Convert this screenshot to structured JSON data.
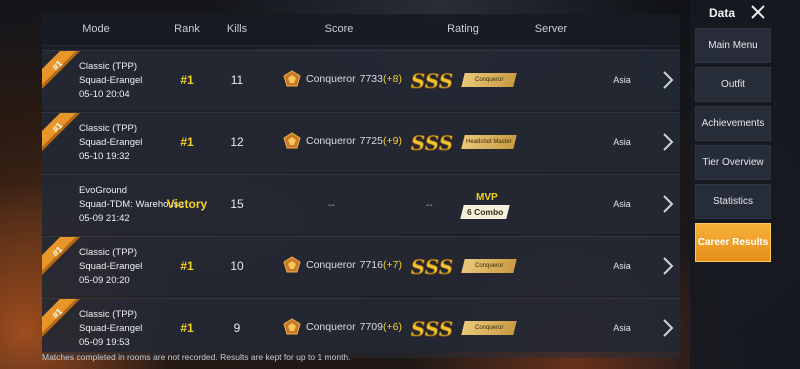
{
  "header": {
    "mode": "Mode",
    "rank": "Rank",
    "kills": "Kills",
    "score": "Score",
    "rating": "Rating",
    "server": "Server"
  },
  "matches": [
    {
      "mode_line1": "Classic (TPP)",
      "mode_line2": "Squad-Erangel",
      "datetime": "05-10 20:04",
      "rank": "#1",
      "kills": "11",
      "tier": "Conqueror",
      "points": "7733",
      "delta": "(+8)",
      "rating_tag": "Conqueror",
      "server": "Asia",
      "badge": "#1"
    },
    {
      "mode_line1": "Classic (TPP)",
      "mode_line2": "Squad-Erangel",
      "datetime": "05-10 19:32",
      "rank": "#1",
      "kills": "12",
      "tier": "Conqueror",
      "points": "7725",
      "delta": "(+9)",
      "rating_tag": "Headshot Master",
      "server": "Asia",
      "badge": "#1"
    },
    {
      "mode_line1": "EvoGround",
      "mode_line2": "Squad-TDM: Warehouse",
      "datetime": "05-09 21:42",
      "rank": "Victory",
      "kills": "15",
      "score_dash": "--",
      "rating_dash": "--",
      "mvp": "MVP",
      "combo": "6 Combo",
      "server": "Asia"
    },
    {
      "mode_line1": "Classic (TPP)",
      "mode_line2": "Squad-Erangel",
      "datetime": "05-09 20:20",
      "rank": "#1",
      "kills": "10",
      "tier": "Conqueror",
      "points": "7716",
      "delta": "(+7)",
      "rating_tag": "Conqueror",
      "server": "Asia",
      "badge": "#1"
    },
    {
      "mode_line1": "Classic (TPP)",
      "mode_line2": "Squad-Erangel",
      "datetime": "05-09 19:53",
      "rank": "#1",
      "kills": "9",
      "tier": "Conqueror",
      "points": "7709",
      "delta": "(+6)",
      "rating_tag": "Conqueror",
      "server": "Asia",
      "badge": "#1"
    }
  ],
  "rating_sss": "SSS",
  "footer": "Matches completed in rooms are not recorded. Results are kept for up to 1 month.",
  "menu": {
    "title": "Data",
    "items": [
      "Main Menu",
      "Outfit",
      "Achievements",
      "Tier Overview",
      "Statistics",
      "Career Results"
    ],
    "active": "Career Results"
  },
  "colors": {
    "accent_gold": "#f3d126",
    "menu_active": "#f0a22a",
    "badge_orange": "#e8962a"
  },
  "icons": {
    "close": "close-icon",
    "chevron": "chevron-right-icon",
    "tier": "conqueror-tier-icon",
    "badge": "rank-one-ribbon-icon",
    "rating": "sss-rating-icon"
  }
}
